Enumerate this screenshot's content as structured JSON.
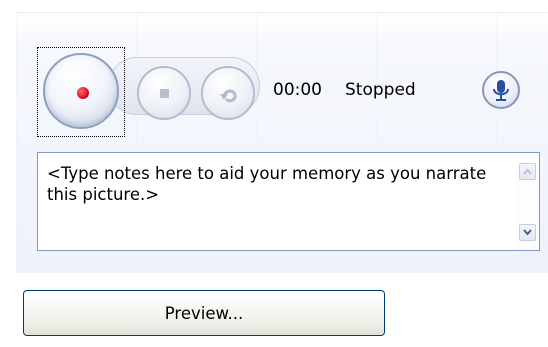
{
  "recorder": {
    "time": "00:00",
    "status": "Stopped"
  },
  "icons": {
    "record": "record-icon",
    "stop": "stop-icon",
    "undo": "undo-icon",
    "microphone": "microphone-icon"
  },
  "colors": {
    "record_dot": "#d4001a",
    "border_blue": "#7f9db9",
    "button_border": "#003c74"
  },
  "notes": {
    "placeholder": "<Type notes here to aid your memory as you narrate this picture.>"
  },
  "preview_button": {
    "label": "Preview..."
  }
}
